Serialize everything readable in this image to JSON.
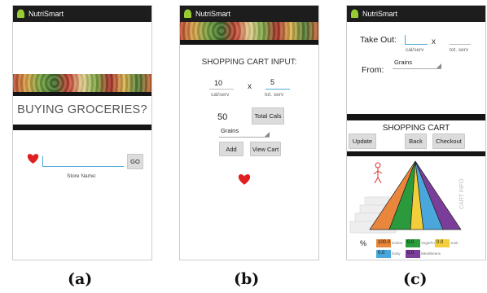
{
  "app": {
    "title": "NutriSmart"
  },
  "screen_a": {
    "banner_title": "BUYING GROCERIES?",
    "input_value": "",
    "go_button": "GO",
    "store_name_label": "Store Name:",
    "caption": "(a)"
  },
  "screen_b": {
    "heading": "SHOPPING CART INPUT:",
    "cal_value": "10",
    "cal_label": "cal/serv",
    "times": "x",
    "serv_value": "5",
    "serv_label": "tot. serv",
    "total_value": "50",
    "total_button": "Total Cals",
    "category": "Grains",
    "add_button": "Add",
    "view_cart_button": "View Cart",
    "caption": "(b)"
  },
  "screen_c": {
    "take_out_label": "Take Out:",
    "take_out_value": "",
    "cal_label": "cal/serv",
    "times": "x",
    "serv_label": "tot. serv",
    "from_label": "From:",
    "category": "Grains",
    "cart_heading": "SHOPPING CART",
    "update_button": "Update",
    "back_button": "Back",
    "checkout_button": "Checkout",
    "side_label": "CART INFO",
    "percent_symbol": "%",
    "legend": [
      {
        "value": "100.0",
        "name": "Grains",
        "color": "#e8873c"
      },
      {
        "value": "0.0",
        "name": "Vege/Fruit",
        "color": "#2a9a3c"
      },
      {
        "value": "0.0",
        "name": "Junk",
        "color": "#f2cf3a"
      },
      {
        "value": "0.0",
        "name": "Dairy",
        "color": "#4aa7dc"
      },
      {
        "value": "0.0",
        "name": "Meat/Beans",
        "color": "#7a3e9a"
      }
    ],
    "caption": "(c)"
  },
  "colors": {
    "accent": "#4da9d6",
    "heart": "#e02020",
    "pyramid": [
      "#e8873c",
      "#2a9a3c",
      "#f2cf3a",
      "#4aa7dc",
      "#7a3e9a"
    ]
  }
}
